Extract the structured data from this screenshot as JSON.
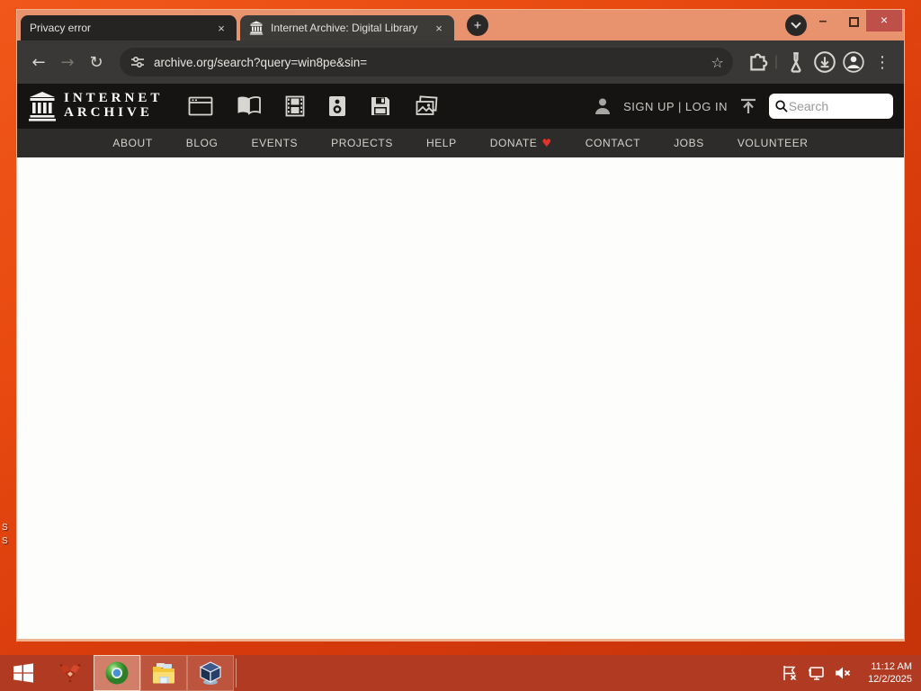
{
  "desktop": {
    "fragments": {
      "f1": "S",
      "f2": "S"
    }
  },
  "browser": {
    "tabs": {
      "0": {
        "title": "Privacy error",
        "close": "×"
      },
      "1": {
        "title": "Internet Archive: Digital Library",
        "close": "×"
      }
    },
    "newtab_glyph": "+",
    "window_controls": {
      "minimize": "–",
      "close": "×"
    },
    "toolbar": {
      "back": "←",
      "forward": "→",
      "reload": "↻",
      "url": "archive.org/search?query=win8pe&sin=",
      "star": "☆",
      "separator": "|",
      "menu": "⋮"
    }
  },
  "ia": {
    "wordmark_line1": "INTERNET",
    "wordmark_line2": "ARCHIVE",
    "account_text": "SIGN UP | LOG IN",
    "search_placeholder": "Search",
    "nav": {
      "0": "ABOUT",
      "1": "BLOG",
      "2": "EVENTS",
      "3": "PROJECTS",
      "4": "HELP",
      "5": "DONATE",
      "6": "CONTACT",
      "7": "JOBS",
      "8": "VOLUNTEER"
    },
    "donate_heart": "♥"
  },
  "taskbar": {
    "clock_time": "11:12 AM",
    "clock_date": "12/2/2025"
  },
  "icons": {
    "tab_favicon": "internet-archive-building",
    "media": [
      "web",
      "texts",
      "video",
      "audio",
      "software",
      "images"
    ],
    "toolbar": [
      "back",
      "forward",
      "reload",
      "site-settings",
      "bookmark-star",
      "extensions",
      "labs-flask",
      "downloads",
      "profile",
      "menu"
    ],
    "taskbar_apps": [
      "windows-start",
      "red-origami-app",
      "chromium",
      "file-explorer",
      "virtualbox"
    ],
    "tray": [
      "action-center-flag-error",
      "network-status",
      "volume-muted"
    ]
  },
  "colors": {
    "frame_salmon": "#e8926e",
    "toolbar_dark": "#3a3836",
    "ia_header": "#161412",
    "ia_nav": "#2e2c2a",
    "taskbar_red": "#b13a22",
    "close_button": "#bf4f49",
    "donate_heart": "#e0342b",
    "desktop_orange": "#e84a10"
  }
}
